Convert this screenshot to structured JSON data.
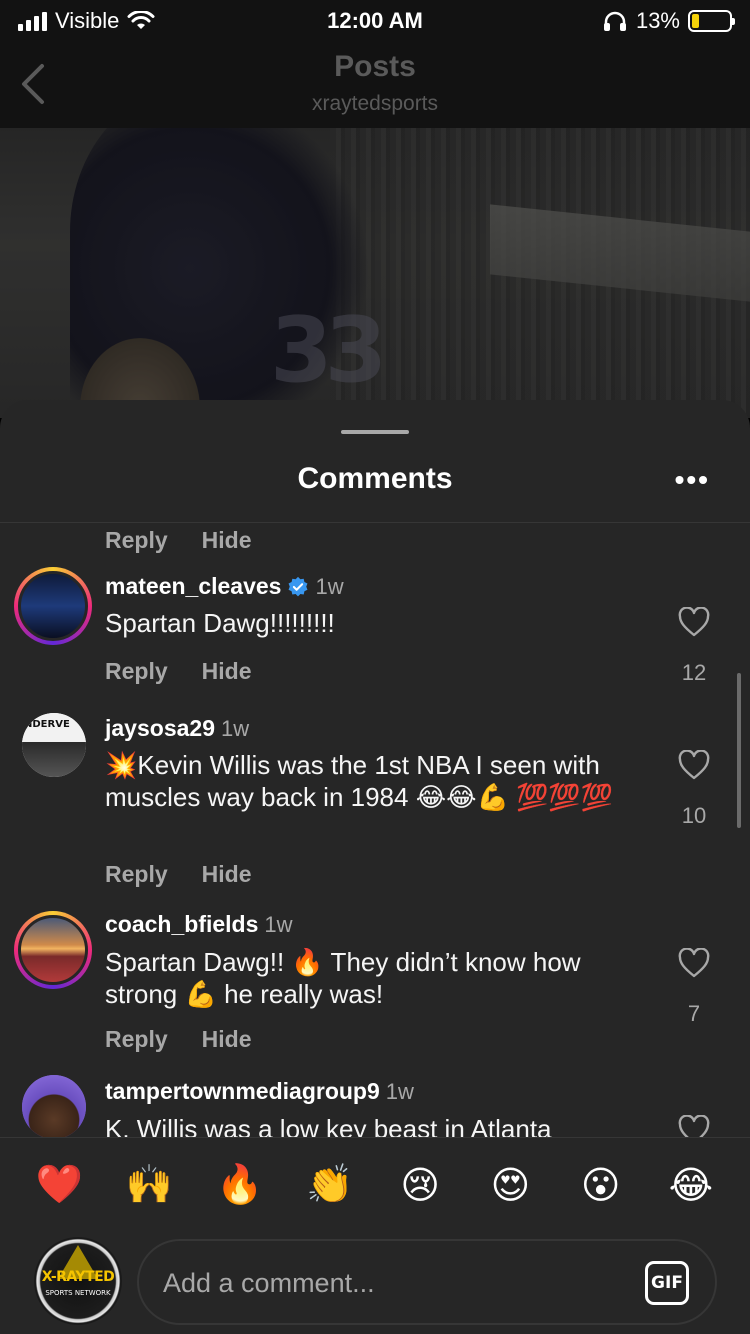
{
  "status_bar": {
    "carrier": "Visible",
    "time": "12:00 AM",
    "battery": "13%",
    "battery_level": 0.13
  },
  "header": {
    "title": "Posts",
    "subtitle": "xraytedsports",
    "back_icon": "chevron-left-icon"
  },
  "sheet": {
    "title": "Comments",
    "more_label": "•••"
  },
  "actions": {
    "reply": "Reply",
    "hide": "Hide"
  },
  "comments": [
    {
      "username": "mateen_cleaves",
      "verified": true,
      "time": "1w",
      "text": "Spartan Dawg!!!!!!!!!",
      "likes": "12"
    },
    {
      "username": "jaysosa29",
      "verified": false,
      "time": "1w",
      "text": "💥Kevin Willis was the 1st NBA I seen with muscles way back in 1984 😂😂💪 💯💯💯",
      "likes": "10",
      "avatar_text": "NDERVE"
    },
    {
      "username": "coach_bfields",
      "verified": false,
      "time": "1w",
      "text": "Spartan Dawg!! 🔥 They didn’t know how strong 💪 he really was!",
      "likes": "7"
    },
    {
      "username": "tampertownmediagroup9",
      "verified": false,
      "time": "1w",
      "text": "K. Willis was a low key beast in Atlanta"
    }
  ],
  "reactions": [
    "❤️",
    "🙌",
    "🔥",
    "👏",
    "😢",
    "😍",
    "😮",
    "😂"
  ],
  "composer": {
    "placeholder": "Add a comment...",
    "gif_label": "GIF",
    "avatar_text": "X-RAYTED",
    "avatar_subtext": "SPORTS NETWORK"
  },
  "colors": {
    "sheet_bg": "#262626",
    "secondary_text": "#a8a8a8",
    "verified": "#3897f0",
    "battery": "#f5d20a"
  }
}
